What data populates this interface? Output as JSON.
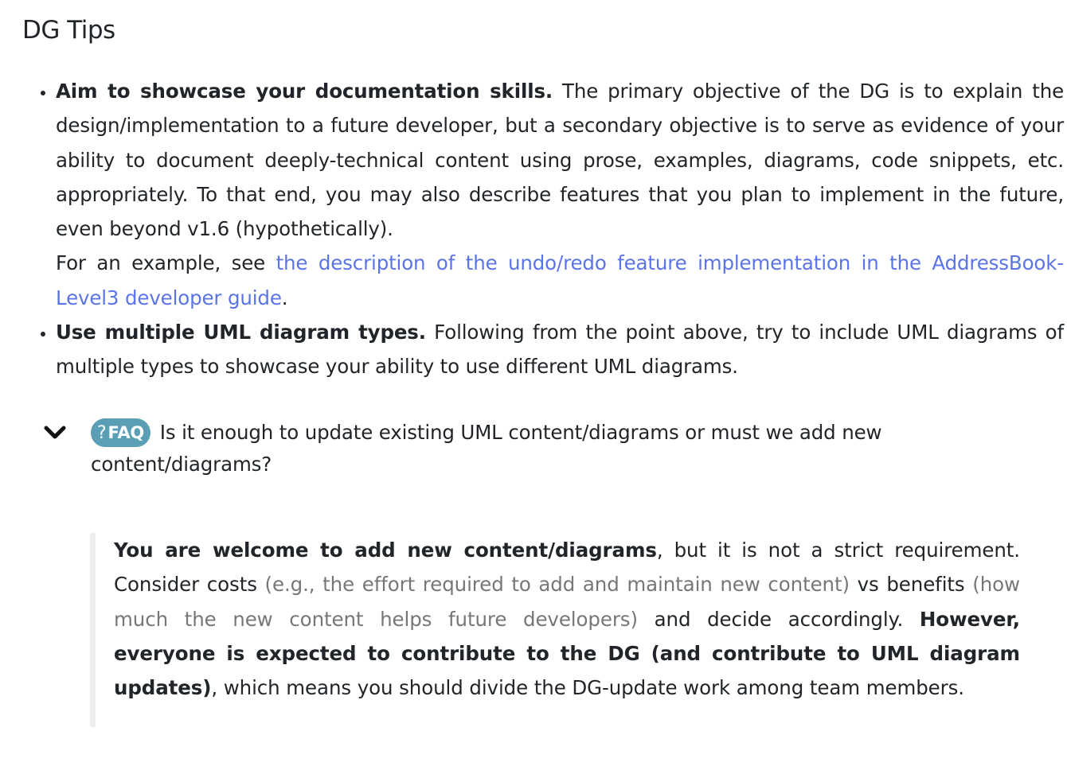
{
  "heading": "DG Tips",
  "tips": [
    {
      "bold": "Aim to showcase your documentation skills.",
      "text": " The primary objective of the DG is to explain the design/implementation to a future developer, but a secondary objective is to serve as evidence of your ability to document deeply-technical content using prose, examples, diagrams, code snippets, etc. appropriately. To that end, you may also describe features that you plan to implement in the future, even beyond v1.6 (hypothetically).",
      "example_prefix": "For an example, see ",
      "example_link": "the description of the undo/redo feature implementation in the AddressBook-Level3 developer guide",
      "example_suffix": "."
    },
    {
      "bold": "Use multiple UML diagram types.",
      "text": " Following from the point above, try to include UML diagrams of multiple types to showcase your ability to use different UML diagrams."
    }
  ],
  "faq": {
    "icon": "chevron-down-icon",
    "badge_symbol": "?",
    "badge_label": "FAQ",
    "question": " Is it enough to update existing UML content/diagrams or must we add new content/diagrams?",
    "badge_color": "#5a9fb5"
  },
  "answer": {
    "bold1": "You are welcome to add new content/diagrams",
    "text1": ", but it is not a strict requirement. Consider costs ",
    "muted1": "(e.g., the effort required to add and maintain new content)",
    "text2": " vs benefits ",
    "muted2": "(how much the new content helps future developers)",
    "text3": " and decide accordingly. ",
    "bold2": "However, everyone is expected to contribute to the DG (and contribute to UML diagram updates)",
    "text4": ", which means you should divide the DG-update work among team members."
  },
  "colors": {
    "link": "#5b74e8",
    "muted": "#777777",
    "quote_border": "#eeeeee"
  }
}
